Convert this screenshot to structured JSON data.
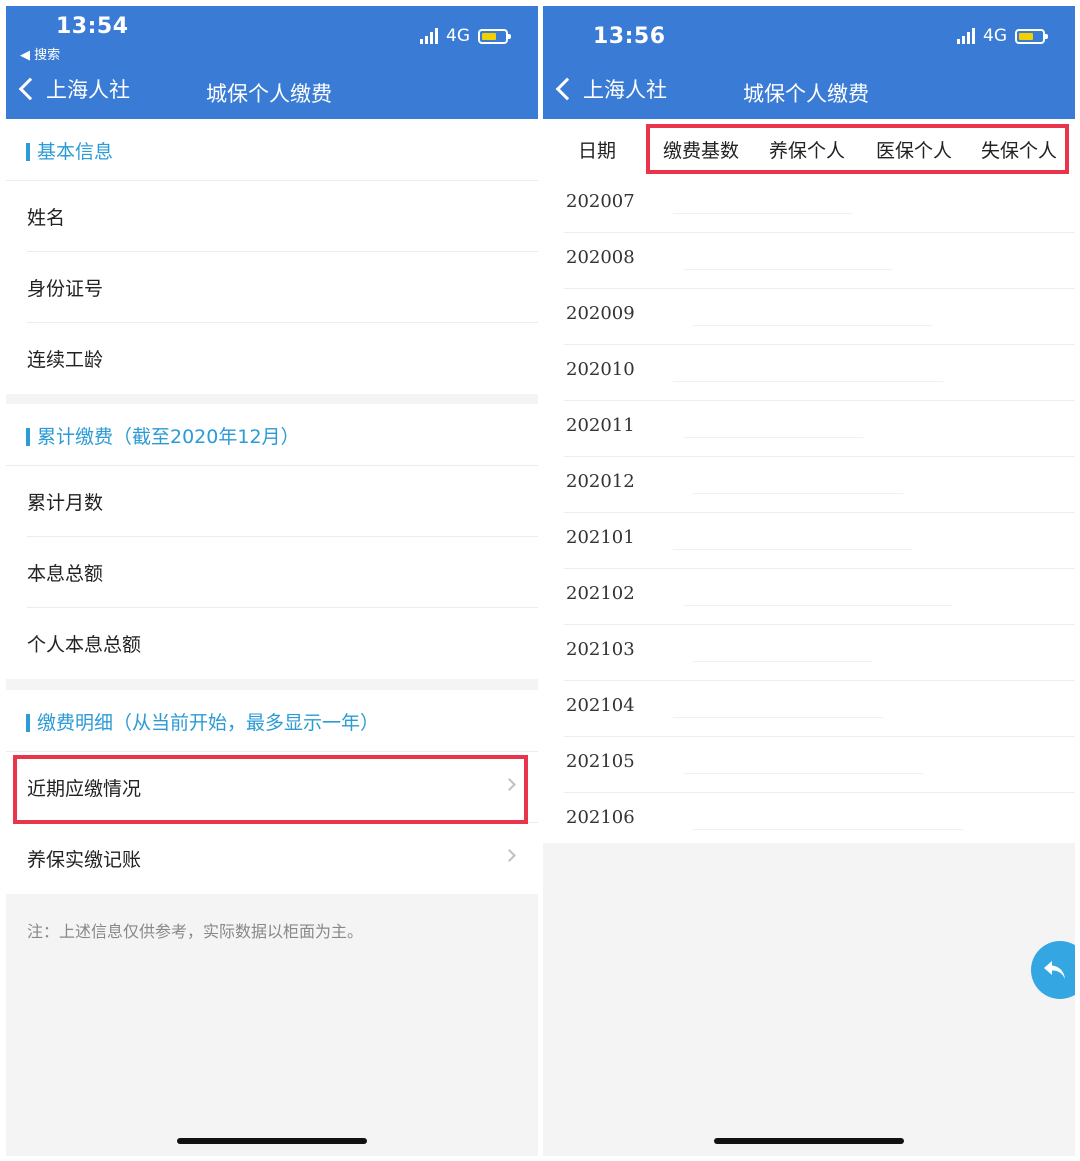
{
  "left": {
    "status": {
      "time": "13:54",
      "back_app": "◀ 搜索",
      "network": "4G"
    },
    "nav": {
      "back_label": "上海人社",
      "title": "城保个人缴费"
    },
    "sections": {
      "basic": {
        "title": "基本信息",
        "rows": [
          "姓名",
          "身份证号",
          "连续工龄"
        ]
      },
      "cumulative": {
        "title": "累计缴费（截至2020年12月）",
        "rows": [
          "累计月数",
          "本息总额",
          "个人本息总额"
        ]
      },
      "detail": {
        "title": "缴费明细（从当前开始，最多显示一年）",
        "rows": [
          "近期应缴情况",
          "养保实缴记账"
        ]
      }
    },
    "note": "注：上述信息仅供参考，实际数据以柜面为主。"
  },
  "right": {
    "status": {
      "time": "13:56",
      "network": "4G"
    },
    "nav": {
      "back_label": "上海人社",
      "title": "城保个人缴费"
    },
    "table": {
      "headers": [
        "日期",
        "缴费基数",
        "养保个人",
        "医保个人",
        "失保个人"
      ],
      "dates": [
        "202007",
        "202008",
        "202009",
        "202010",
        "202011",
        "202012",
        "202101",
        "202102",
        "202103",
        "202104",
        "202105",
        "202106"
      ]
    }
  },
  "colors": {
    "header_blue": "#3a7cd5",
    "section_accent": "#2b9bd5",
    "highlight_red": "#e8354b",
    "fab_blue": "#34a7e3"
  },
  "icons": {
    "back": "chevron-left-icon",
    "row_arrow": "chevron-right-icon",
    "fab": "reply-icon"
  }
}
